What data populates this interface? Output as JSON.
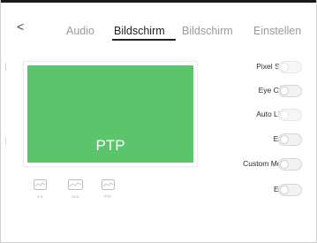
{
  "nav": {
    "back_glyph": "<"
  },
  "tabs": [
    {
      "label": "Audio",
      "active": false
    },
    {
      "label": "Bildschirm",
      "active": true
    },
    {
      "label": "Bildschirm",
      "active": false
    },
    {
      "label": "Einstellen",
      "active": false
    }
  ],
  "preview": {
    "label": "PTP",
    "color": "#5cc46b"
  },
  "modes": [
    {
      "label": "4:3",
      "icon": "aspect-4-3-icon"
    },
    {
      "label": "16:9",
      "icon": "aspect-16-9-icon"
    },
    {
      "label": "PTP",
      "icon": "ptp-icon"
    }
  ],
  "settings": [
    {
      "label": "Pixel Shift",
      "on": false
    },
    {
      "label": "Eye Care",
      "on": false
    },
    {
      "label": "Auto Licht",
      "on": false
    },
    {
      "label": "ECO",
      "on": false
    },
    {
      "label": "Custom Mode",
      "on": false
    },
    {
      "label": "ECR",
      "on": false
    }
  ]
}
